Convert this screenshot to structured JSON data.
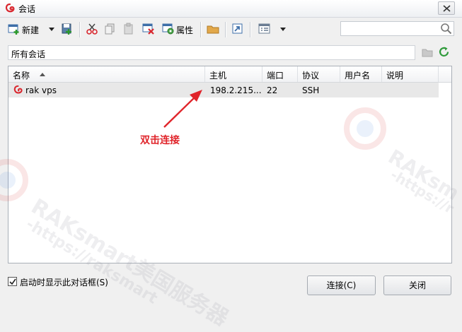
{
  "window": {
    "title": "会话",
    "app_icon": "swirl-logo-icon",
    "accent_color": "#d9272e"
  },
  "toolbar": {
    "new_label": "新建",
    "properties_label": "属性"
  },
  "search": {
    "value": "",
    "placeholder": ""
  },
  "path_bar": {
    "label": "所有会话"
  },
  "columns": {
    "name": "名称",
    "host": "主机",
    "port": "端口",
    "protocol": "协议",
    "username": "用户名",
    "description": "说明"
  },
  "sessions": [
    {
      "name": "rak vps",
      "host": "198.2.215....",
      "port": "22",
      "protocol": "SSH",
      "username": "",
      "description": ""
    }
  ],
  "annotation": {
    "text": "双击连接",
    "color": "#e0242a"
  },
  "watermark": {
    "brand": "RAKsmart美国服务器",
    "url": "-https://raksmart",
    "brand_short": "RAKsm",
    "url_short": "-https://r"
  },
  "footer": {
    "show_on_startup_label": "启动时显示此对话框(S)",
    "show_on_startup_checked": true,
    "connect_label": "连接(C)",
    "close_label": "关闭"
  }
}
